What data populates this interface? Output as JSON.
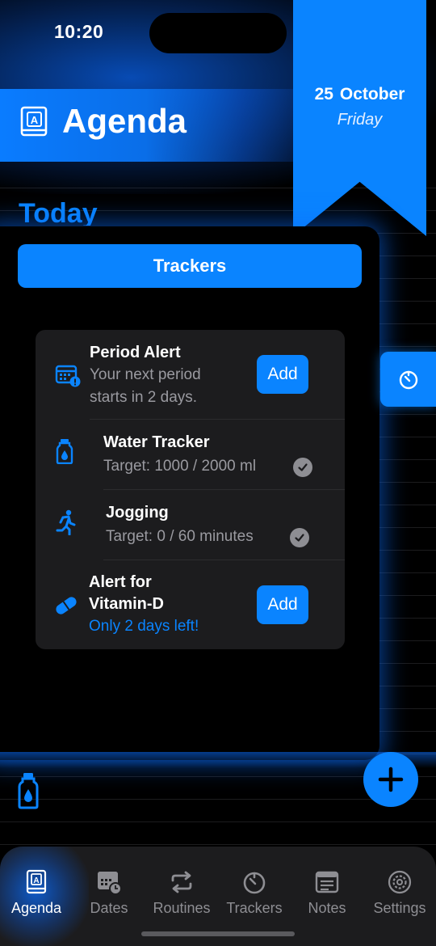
{
  "status_bar": {
    "time": "10:20"
  },
  "header": {
    "title": "Agenda"
  },
  "date_ribbon": {
    "day": "25",
    "month": "October",
    "weekday": "Friday"
  },
  "section_title": "Today",
  "trackers_button": "Trackers",
  "card": {
    "period_alert": {
      "title": "Period Alert",
      "line1": "Your next period",
      "line2": "starts in 2 days.",
      "action": "Add"
    },
    "water_tracker": {
      "title": "Water Tracker",
      "subtitle": "Target: 1000 / 2000 ml"
    },
    "jogging": {
      "title": "Jogging",
      "subtitle": "Target: 0 / 60 minutes"
    },
    "vitamin_alert": {
      "title_line1": "Alert for",
      "title_line2": "Vitamin-D",
      "subtitle": "Only 2 days left!",
      "action": "Add"
    }
  },
  "tab_bar": {
    "items": [
      {
        "label": "Agenda",
        "icon": "book-icon",
        "active": true
      },
      {
        "label": "Dates",
        "icon": "calendar-clock-icon",
        "active": false
      },
      {
        "label": "Routines",
        "icon": "repeat-icon",
        "active": false
      },
      {
        "label": "Trackers",
        "icon": "timer-icon",
        "active": false
      },
      {
        "label": "Notes",
        "icon": "notes-icon",
        "active": false
      },
      {
        "label": "Settings",
        "icon": "gear-icon",
        "active": false
      }
    ]
  },
  "colors": {
    "accent": "#0a84ff",
    "card": "#1c1c1e",
    "secondary_text": "#9a9aa0"
  }
}
